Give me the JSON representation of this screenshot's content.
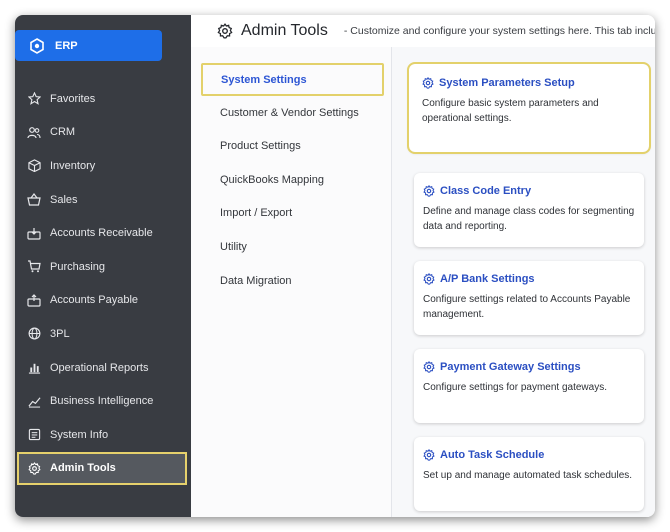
{
  "colors": {
    "sidebar_bg": "#393c42",
    "accent": "#1e6ee8",
    "highlight": "#e3d16b",
    "link": "#2b4fc2"
  },
  "sidebar": {
    "erp_label": "ERP",
    "items": [
      {
        "label": "Favorites",
        "icon": "star-icon"
      },
      {
        "label": "CRM",
        "icon": "users-icon"
      },
      {
        "label": "Inventory",
        "icon": "box-icon"
      },
      {
        "label": "Sales",
        "icon": "basket-icon"
      },
      {
        "label": "Accounts Receivable",
        "icon": "receivable-icon"
      },
      {
        "label": "Purchasing",
        "icon": "cart-icon"
      },
      {
        "label": "Accounts Payable",
        "icon": "payable-icon"
      },
      {
        "label": "3PL",
        "icon": "globe-icon"
      },
      {
        "label": "Operational Reports",
        "icon": "bar-chart-icon"
      },
      {
        "label": "Business Intelligence",
        "icon": "trend-icon"
      },
      {
        "label": "System Info",
        "icon": "info-icon"
      },
      {
        "label": "Admin Tools",
        "icon": "gear-icon",
        "active": true
      }
    ]
  },
  "header": {
    "title": "Admin Tools",
    "description": "- Customize and configure your system settings here. This tab inclu"
  },
  "tabs": [
    {
      "label": "System Settings",
      "active": true
    },
    {
      "label": "Customer & Vendor Settings"
    },
    {
      "label": "Product Settings"
    },
    {
      "label": "QuickBooks Mapping"
    },
    {
      "label": "Import / Export"
    },
    {
      "label": "Utility"
    },
    {
      "label": "Data Migration"
    }
  ],
  "cards": [
    {
      "title": "System Parameters Setup",
      "desc": "Configure basic system parameters and operational settings.",
      "selected": true
    },
    {
      "title": "Class Code Entry",
      "desc": "Define and manage class codes for segmenting data and reporting."
    },
    {
      "title": "A/P Bank Settings",
      "desc": "Configure settings related to Accounts Payable management."
    },
    {
      "title": "Payment Gateway Settings",
      "desc": "Configure settings for payment gateways."
    },
    {
      "title": "Auto Task Schedule",
      "desc": "Set up and manage automated task schedules."
    }
  ]
}
